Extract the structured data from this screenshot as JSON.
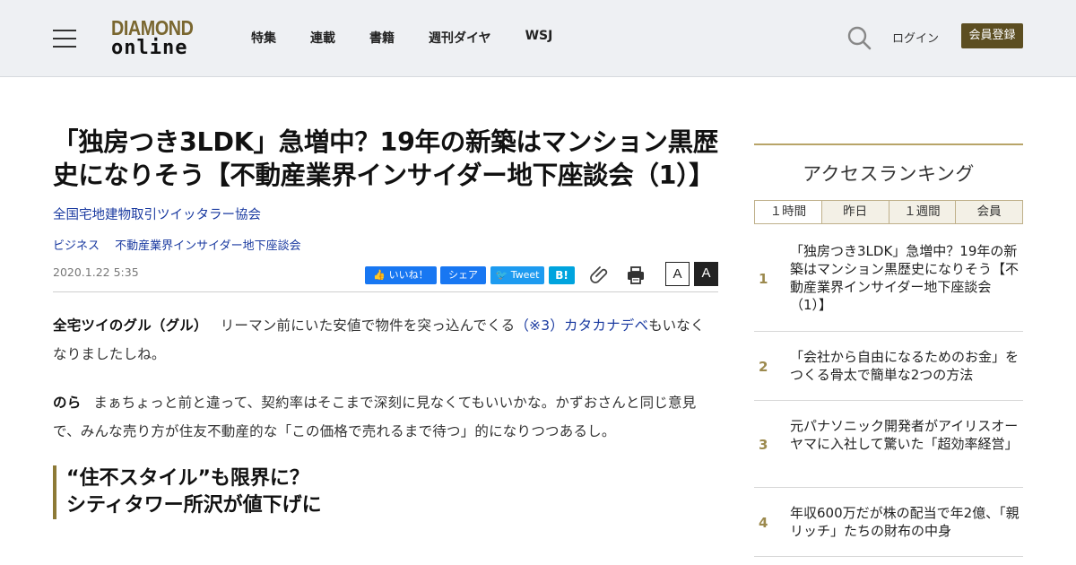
{
  "header": {
    "logo_top": "DIAMOND",
    "logo_bottom": "online",
    "nav": [
      "特集",
      "連載",
      "書籍",
      "週刊ダイヤ",
      "WSJ"
    ],
    "login": "ログイン",
    "register": "会員登録"
  },
  "article": {
    "title": "「独房つき3LDK」急増中？19年の新築はマンション黒歴史になりそう【不動産業界インサイダー地下座談会（1）】",
    "author": "全国宅地建物取引ツイッタラー協会",
    "tags": [
      "ビジネス",
      "不動産業界インサイダー地下座談会"
    ],
    "date": "2020.1.22 5:35",
    "share": {
      "like": "いいね！",
      "facebook": "シェア",
      "tweet": "Tweet",
      "hatena": "B!"
    },
    "font_small": "A",
    "font_large": "A",
    "paragraphs": [
      {
        "speaker": "全宅ツイのグル（グル）",
        "text_before": "リーマン前にいた安値で物件を突っ込んでくる",
        "link": "（※3）カタカナデベ",
        "text_after": "もいなくなりましたしね。"
      },
      {
        "speaker": "のら",
        "text": "まぁちょっと前と違って、契約率はそこまで深刻に見なくてもいいかな。かずおさんと同じ意見で、みんな売り方が住友不動産的な「この価格で売れるまで待つ」的になりつつあるし。"
      }
    ],
    "subhead_line1": "“住不スタイル”も限界に？",
    "subhead_line2": "シティタワー所沢が値下げに"
  },
  "sidebar": {
    "title": "アクセスランキング",
    "tabs": [
      "１時間",
      "昨日",
      "１週間",
      "会員"
    ],
    "active_tab": 0,
    "items": [
      {
        "rank": "1",
        "text": "「独房つき3LDK」急増中？19年の新築はマンション黒歴史になりそう【不動産業界インサイダー地下座談会（1）】"
      },
      {
        "rank": "2",
        "text": "「会社から自由になるためのお金」をつくる骨太で簡単な2つの方法"
      },
      {
        "rank": "3",
        "text": "元パナソニック開発者がアイリスオーヤマに入社して驚いた「超効率経営」"
      },
      {
        "rank": "4",
        "text": "年収600万だが株の配当で年2億、「親リッチ」たちの財布の中身"
      }
    ]
  },
  "colors": {
    "header_bg": "#eef0f3",
    "accent_gold": "#9c8a4e",
    "register_bg": "#5c4e21",
    "link_blue": "#1a3aa0"
  }
}
